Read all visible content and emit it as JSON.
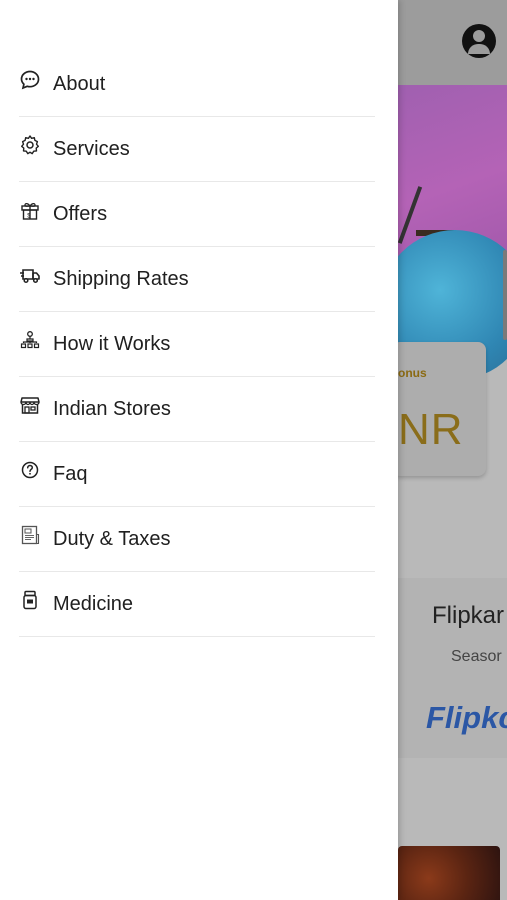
{
  "drawer": {
    "items": [
      {
        "label": "About",
        "icon": "chat-bubble-icon"
      },
      {
        "label": "Services",
        "icon": "gear-icon"
      },
      {
        "label": "Offers",
        "icon": "gift-icon"
      },
      {
        "label": "Shipping Rates",
        "icon": "delivery-truck-icon"
      },
      {
        "label": "How it Works",
        "icon": "hierarchy-icon"
      },
      {
        "label": "Indian Stores",
        "icon": "storefront-icon"
      },
      {
        "label": "Faq",
        "icon": "question-circle-icon"
      },
      {
        "label": "Duty & Taxes",
        "icon": "tax-document-icon"
      },
      {
        "label": "Medicine",
        "icon": "medicine-bottle-icon"
      }
    ]
  },
  "background": {
    "bonus_label": "onus",
    "bonus_value": "NR",
    "store_title": "Flipkar",
    "store_subtitle": "Seasor",
    "store_logo": "Flipkc"
  },
  "colors": {
    "brand_blue": "#2b57a5",
    "bonus_gold": "#8a6d1a",
    "overlay": "#b9b9b9"
  }
}
